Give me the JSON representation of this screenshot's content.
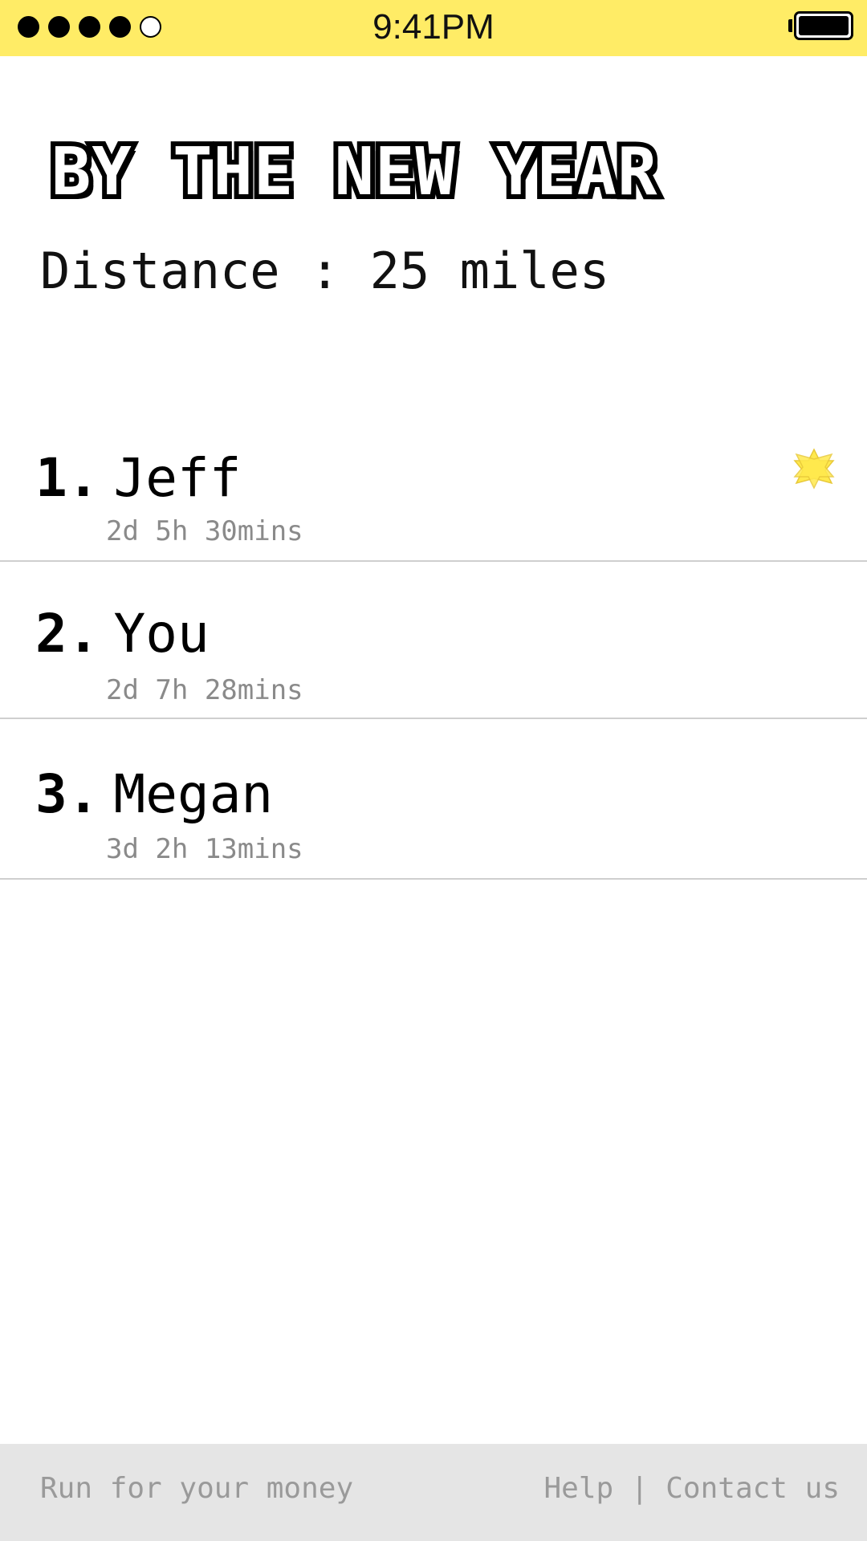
{
  "status_bar": {
    "time": "9:41PM",
    "signal_filled": 4,
    "signal_total": 5,
    "battery_level": 1.0,
    "background_color": "#ffec66"
  },
  "header": {
    "title": "BY THE NEW YEAR",
    "distance": "Distance : 25 miles"
  },
  "leaderboard": [
    {
      "rank": "1.",
      "name": "Jeff",
      "time": "2d 5h 30mins",
      "leader_icon": "star-icon"
    },
    {
      "rank": "2.",
      "name": "You",
      "time": "2d 7h 28mins"
    },
    {
      "rank": "3.",
      "name": "Megan",
      "time": "3d 2h 13mins"
    }
  ],
  "footer": {
    "tagline": "Run for your money",
    "help": "Help",
    "separator": "|",
    "contact": "Contact us"
  },
  "colors": {
    "accent": "#ffec66",
    "star": "#ffe94d",
    "muted_text": "#8a8a8a"
  }
}
